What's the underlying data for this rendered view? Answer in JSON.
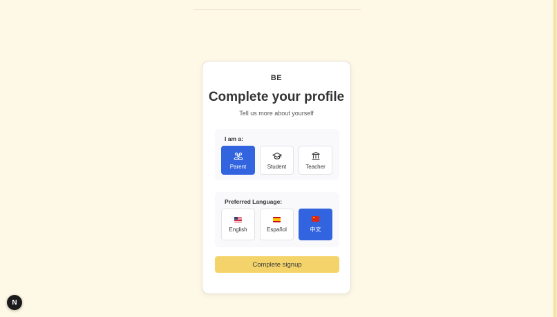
{
  "brand": "BE",
  "title": "Complete your profile",
  "subtitle": "Tell us more about yourself",
  "role_section": {
    "label": "I am a:",
    "options": [
      {
        "label": "Parent",
        "icon": "family-icon",
        "selected": true
      },
      {
        "label": "Student",
        "icon": "graduation-cap-icon",
        "selected": false
      },
      {
        "label": "Teacher",
        "icon": "school-building-icon",
        "selected": false
      }
    ]
  },
  "language_section": {
    "label": "Preferred Language:",
    "options": [
      {
        "label": "English",
        "icon": "us-flag-icon",
        "selected": false
      },
      {
        "label": "Español",
        "icon": "spain-flag-icon",
        "selected": false
      },
      {
        "label": "中文",
        "icon": "china-flag-icon",
        "selected": true
      }
    ]
  },
  "submit_label": "Complete signup",
  "dev_badge": "N",
  "colors": {
    "background": "#fef8e6",
    "selected": "#3264e0",
    "submit": "#f4d46a"
  }
}
